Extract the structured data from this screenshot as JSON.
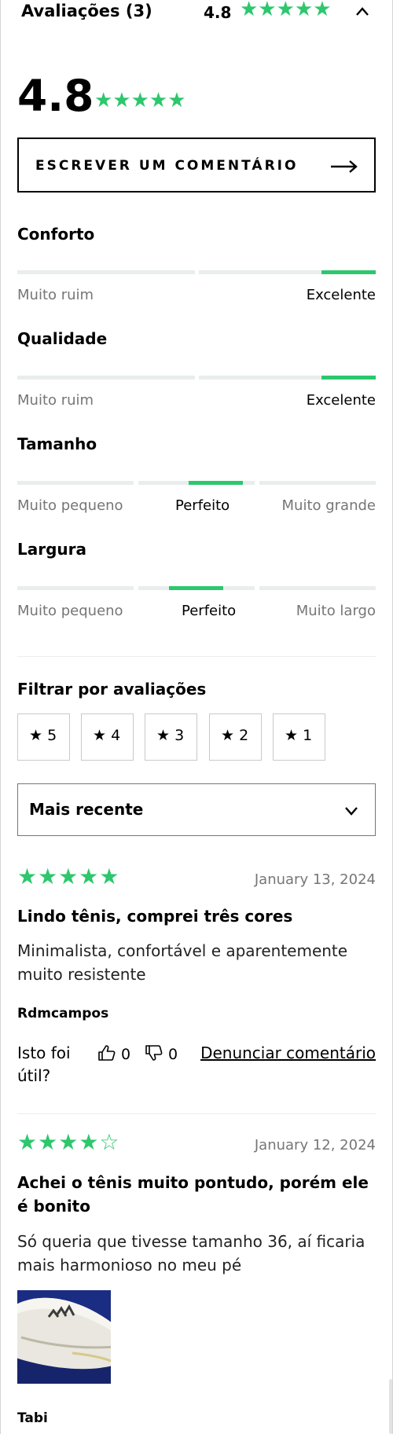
{
  "header": {
    "title": "Avaliações (3)",
    "rating": "4.8",
    "stars": "★★★★★",
    "chevron": "chevron-up-icon"
  },
  "summary": {
    "rating": "4.8",
    "stars": "★★★★★",
    "stars_value": 4.8
  },
  "write_review": {
    "label": "ESCREVER UM COMENTÁRIO",
    "icon": "arrow-right-icon"
  },
  "attributes": [
    {
      "title": "Conforto",
      "left_label": "Muito ruim",
      "right_label": "Excelente",
      "value": 0.92
    },
    {
      "title": "Qualidade",
      "left_label": "Muito ruim",
      "right_label": "Excelente",
      "value": 0.92
    },
    {
      "title": "Tamanho",
      "left_label": "Muito pequeno",
      "mid_label": "Perfeito",
      "right_label": "Muito grande",
      "value": 0.5
    },
    {
      "title": "Largura",
      "left_label": "Muito pequeno",
      "mid_label": "Perfeito",
      "right_label": "Muito largo",
      "value": 0.45
    }
  ],
  "filter": {
    "title": "Filtrar por avaliações",
    "star_glyph": "★",
    "options": [
      "5",
      "4",
      "3",
      "2",
      "1"
    ]
  },
  "sort": {
    "selected": "Mais recente",
    "icon": "chevron-down-icon"
  },
  "reviews": [
    {
      "stars": "★★★★★",
      "rating": 5,
      "date": "January 13, 2024",
      "title": "Lindo tênis, comprei três cores",
      "body": "Minimalista, confortável e aparentemente muito resistente",
      "author": "Rdmcampos",
      "useful_label": "Isto foi útil?",
      "likes": "0",
      "dislikes": "0",
      "report": "Denunciar comentário"
    },
    {
      "stars": "★★★★☆",
      "rating": 4,
      "date": "January 12, 2024",
      "title": "Achei o tênis muito pontudo, porém ele é bonito",
      "body": "Só queria que tivesse tamanho 36, aí ficaria mais harmonioso no meu pé",
      "author": "Tabi"
    }
  ],
  "colors": {
    "accent_green": "#2dc76d",
    "muted_text": "#767677",
    "track": "#e9edee"
  }
}
